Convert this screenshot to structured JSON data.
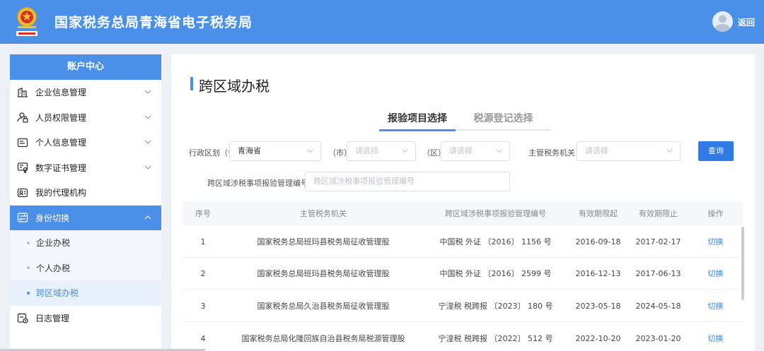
{
  "header": {
    "title": "国家税务总局青海省电子税务局",
    "emblem_icon": "tax-emblem-icon",
    "user_icon": "user-avatar-icon",
    "back_label": "返回"
  },
  "sidebar": {
    "header": "账户中心",
    "items": [
      {
        "label": "企业信息管理",
        "icon": "building-icon",
        "expandable": true
      },
      {
        "label": "人员权限管理",
        "icon": "user-lock-icon",
        "expandable": true
      },
      {
        "label": "个人信息管理",
        "icon": "id-card-icon",
        "expandable": true
      },
      {
        "label": "数字证书管理",
        "icon": "certificate-icon",
        "expandable": true
      },
      {
        "label": "我的代理机构",
        "icon": "agency-icon",
        "expandable": false
      },
      {
        "label": "身份切换",
        "icon": "switch-icon",
        "expandable": true,
        "expanded": true,
        "active": true
      },
      {
        "label": "日志管理",
        "icon": "log-icon",
        "expandable": false
      }
    ],
    "sub_items": [
      {
        "label": "企业办税"
      },
      {
        "label": "个人办税"
      },
      {
        "label": "跨区域办税",
        "current": true
      }
    ]
  },
  "main": {
    "title": "跨区域办税",
    "tabs": [
      {
        "label": "报验项目选择",
        "active": true
      },
      {
        "label": "税源登记选择",
        "active": false
      }
    ],
    "filters": {
      "province_label": "行政区划（省）",
      "province_value": "青海省",
      "city_label": "（市）",
      "city_placeholder": "请选择",
      "district_label": "（区）",
      "district_placeholder": "请选择",
      "authority_label": "主管税务机关",
      "authority_placeholder": "请选择",
      "code_label": "跨区域涉税事项报验管理编号",
      "code_placeholder": "跨区域涉税事项报验管理编号",
      "query_button": "查询"
    },
    "table": {
      "columns": [
        "序号",
        "主管税务机关",
        "跨区域涉税事项报验管理编号",
        "有效期限起",
        "有效期限止",
        "操作"
      ],
      "rows": [
        {
          "seq": "1",
          "org": "国家税务总局班玛县税务局征收管理股",
          "code": "中国税 外证 〔2016〕 1156 号",
          "start": "2016-09-18",
          "end": "2017-02-17",
          "action": "切换"
        },
        {
          "seq": "2",
          "org": "国家税务总局班玛县税务局征收管理股",
          "code": "中国税 外证 〔2016〕 2599 号",
          "start": "2016-12-13",
          "end": "2017-06-13",
          "action": "切换"
        },
        {
          "seq": "3",
          "org": "国家税务总局久治县税务局征收管理股",
          "code": "宁湟税 税跨报 〔2023〕 180 号",
          "start": "2023-05-18",
          "end": "2024-05-18",
          "action": "切换"
        },
        {
          "seq": "4",
          "org": "国家税务总局化隆回族自治县税务局税源管理股",
          "code": "宁湟税 税跨报 〔2022〕 512 号",
          "start": "2022-10-20",
          "end": "2023-01-20",
          "action": "切换"
        }
      ]
    }
  },
  "colors": {
    "brand": "#4a8fe8",
    "button": "#2f7ae5",
    "link": "#3d87e8"
  }
}
